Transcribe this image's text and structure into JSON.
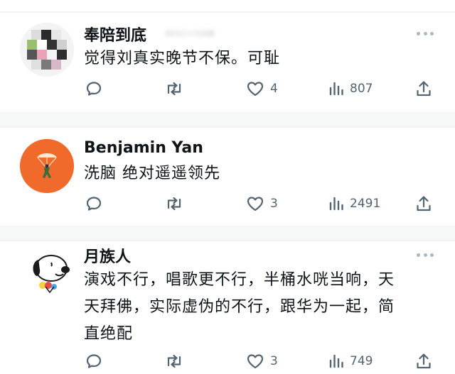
{
  "posts": [
    {
      "username": "奉陪到底",
      "text": "觉得刘真实晚节不保。可耻",
      "likes": "4",
      "views": "807",
      "avatar": "pixelated-avatar"
    },
    {
      "username": "Benjamin Yan",
      "text": "洗脑 绝对遥遥领先",
      "likes": "3",
      "views": "2491",
      "avatar": "orange-parachute-avatar"
    },
    {
      "username": "月族人",
      "text_lines": [
        "演戏不行，唱歌更不行，半桶水咣当响，天",
        "天拜佛，实际虚伪的不行，跟华为一起，简",
        "直绝配"
      ],
      "likes": "3",
      "views": "749",
      "avatar": "snoopy-avatar"
    }
  ],
  "icons": [
    "more-icon",
    "reply-icon",
    "retweet-icon",
    "like-icon",
    "views-icon",
    "share-icon"
  ],
  "colors": {
    "text": "#0f1419",
    "muted": "#536471",
    "divider": "#eff3f4",
    "avatar_orange": "#ef6a2b"
  }
}
